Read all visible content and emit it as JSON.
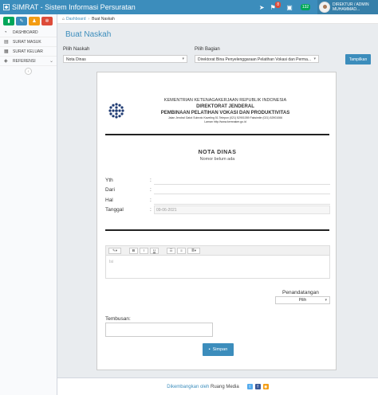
{
  "app": {
    "title": "SIMRAT - Sistem Informasi Persuratan"
  },
  "topnav": {
    "notif_badge": "8",
    "msg_badge": "132",
    "user_line1": "DIREKTUR / ADMIN",
    "user_line2": "MUHAMMAD..."
  },
  "sidebar": {
    "items": [
      {
        "label": "DASHBOARD",
        "icon": "dashboard-icon"
      },
      {
        "label": "SURAT MASUK",
        "icon": "inbox-icon"
      },
      {
        "label": "SURAT KELUAR",
        "icon": "outbox-icon"
      },
      {
        "label": "REFERENSI",
        "icon": "reference-icon"
      }
    ]
  },
  "breadcrumb": {
    "home": "Dashboard",
    "current": "Buat Naskah"
  },
  "page": {
    "title": "Buat Naskah"
  },
  "filters": {
    "naskah_label": "Pilih Naskah",
    "naskah_value": "Nota Dinas",
    "bagian_label": "Pilih Bagian",
    "bagian_value": "Direktorat Bina Penyelenggaraan Pelatihan Vokasi dan Perma...",
    "show_button": "Tampilkan"
  },
  "kop": {
    "line1": "KEMENTRIAN KETENAGAKERJAAN REPUBLIK INDONESIA",
    "line2": "DIREKTORAT JENDERAL",
    "line3": "PEMBINAAN PELATIHAN VOKASI DAN PRODUKTIVITAS",
    "line4": "Jalan Jendral Gatot Subroto Kaveling 51 Telepon (021) 52901059 Faksimile (021) 52901066",
    "line5": "Laman http://www.kemnaker.go.id"
  },
  "doc": {
    "title": "NOTA DINAS",
    "number": "Nomor belum ada",
    "fields": [
      {
        "label": "Yth",
        "colon": ":",
        "value": ""
      },
      {
        "label": "Dari",
        "colon": ":",
        "value": ""
      },
      {
        "label": "Hal",
        "colon": ":",
        "value": ""
      },
      {
        "label": "Tanggal",
        "colon": ":",
        "value": "09-06-2021"
      }
    ],
    "editor_placeholder": "Isi",
    "signer_label": "Penandatangan",
    "signer_value": "Pilih",
    "cc_label": "Tembusan:",
    "save_button": "Simpan"
  },
  "footer": {
    "prefix": "Dikembangkan oleh",
    "org": "Ruang Media"
  }
}
